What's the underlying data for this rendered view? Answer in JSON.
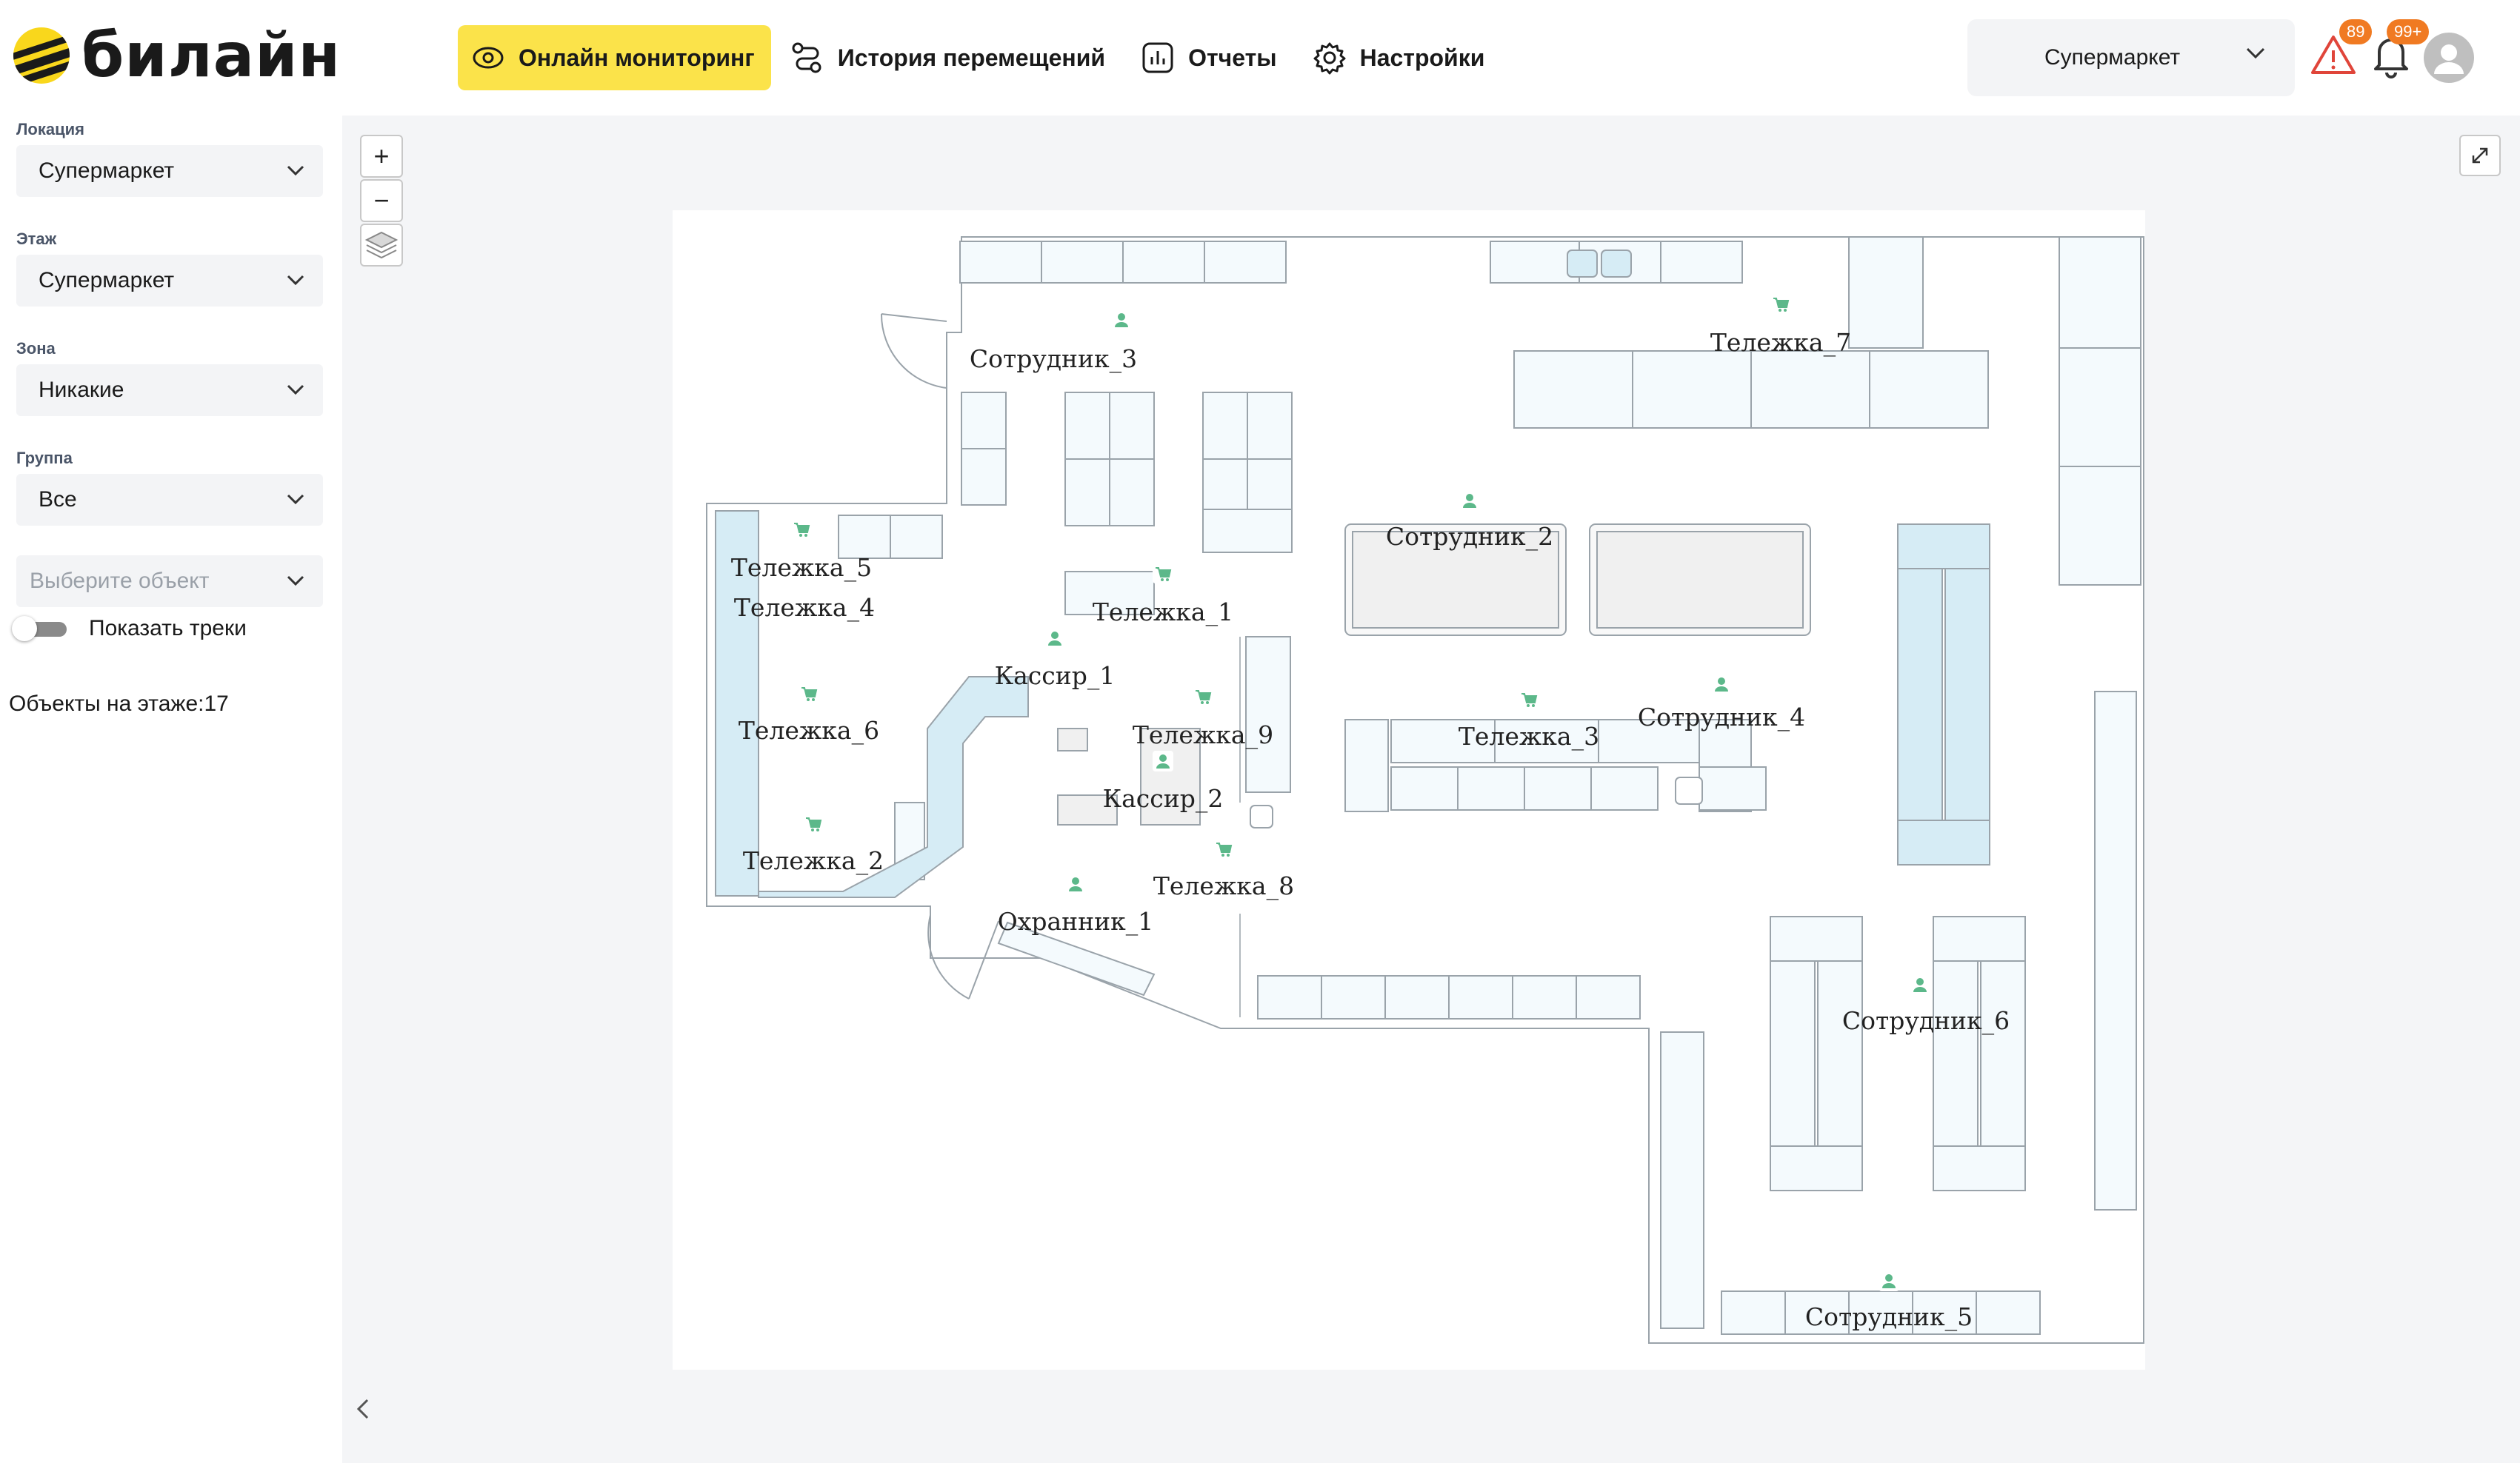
{
  "brand": {
    "logo_text": "билайн"
  },
  "nav": {
    "items": [
      {
        "label": "Онлайн мониторинг",
        "icon": "eye-icon",
        "active": true
      },
      {
        "label": "История перемещений",
        "icon": "route-icon"
      },
      {
        "label": "Отчеты",
        "icon": "report-icon"
      },
      {
        "label": "Настройки",
        "icon": "gear-icon"
      }
    ],
    "active_color": "#fbe34a"
  },
  "header": {
    "store_select": "Супермаркет",
    "alerts_badge": "89",
    "notifications_badge": "99+",
    "badge_color": "#f07a22"
  },
  "sidebar": {
    "location": {
      "label": "Локация",
      "value": "Супермаркет"
    },
    "floor": {
      "label": "Этаж",
      "value": "Супермаркет"
    },
    "zone": {
      "label": "Зона",
      "value": "Никакие"
    },
    "group": {
      "label": "Группа",
      "value": "Все"
    },
    "object": {
      "placeholder": "Выберите объект"
    },
    "show_tracks": {
      "label": "Показать треки",
      "on": false
    },
    "objects_on_floor": "Объекты на этаже:17"
  },
  "map": {
    "zoom_in": "+",
    "zoom_out": "−",
    "marker_color": "#5cb88a",
    "shelf_color": "#d6ecf5",
    "labels": {
      "emp3": "Сотрудник_3",
      "cart7": "Тележка_7",
      "cart5": "Тележка_5",
      "cart4": "Тележка_4",
      "cart1": "Тележка_1",
      "emp2": "Сотрудник_2",
      "cashier1": "Кассир_1",
      "cart6": "Тележка_6",
      "cart9": "Тележка_9",
      "cart3": "Тележка_3",
      "emp4": "Сотрудник_4",
      "cashier2": "Кассир_2",
      "cart2": "Тележка_2",
      "cart8": "Тележка_8",
      "guard1": "Охранник_1",
      "emp6": "Сотрудник_6",
      "emp5": "Сотрудник_5"
    }
  }
}
